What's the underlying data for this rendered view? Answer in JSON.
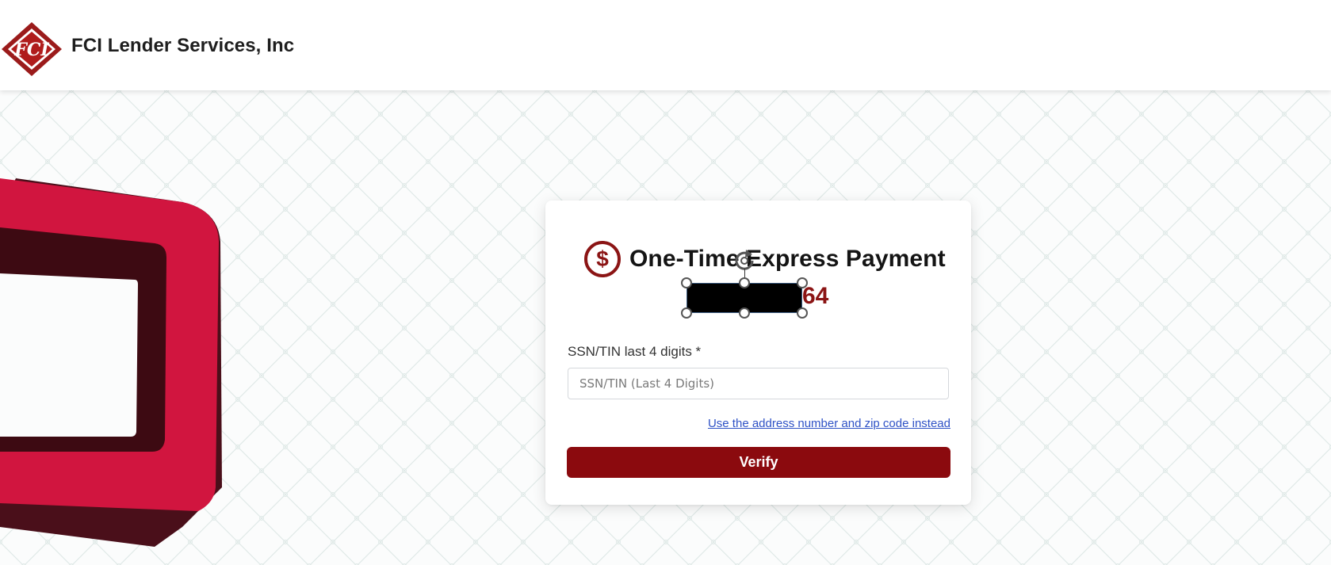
{
  "header": {
    "brand_name": "FCI Lender Services, Inc"
  },
  "card": {
    "title": "One-Time Express Payment",
    "masked_id_suffix": "64",
    "ssn_field": {
      "label": "SSN/TIN last 4 digits *",
      "placeholder": "SSN/TIN (Last 4 Digits)",
      "value": ""
    },
    "alt_link": "Use the address number and zip code instead",
    "verify_label": "Verify"
  },
  "icons": {
    "logo": "fci-logo-icon",
    "title": "dollar-circle-icon",
    "rotate": "rotate-handle-icon"
  },
  "colors": {
    "brand_red": "#8b0a0e",
    "accent_pink": "#d11745",
    "link_blue": "#2f52c6"
  }
}
